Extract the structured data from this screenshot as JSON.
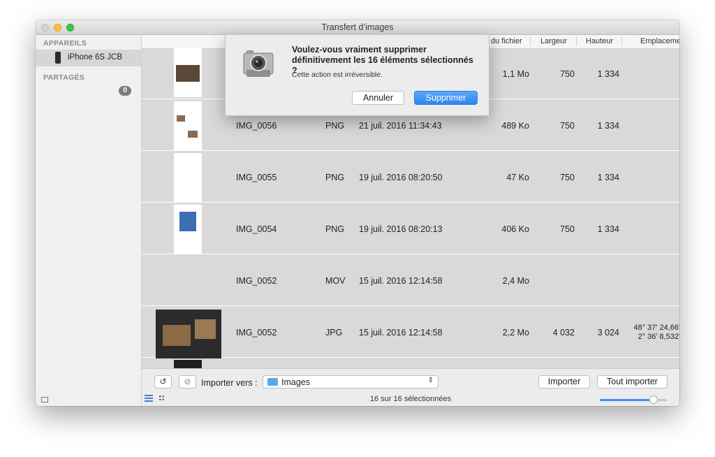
{
  "window": {
    "title": "Transfert d’images"
  },
  "sidebar": {
    "devices_header": "APPAREILS",
    "device_name": "iPhone 6S JCB",
    "shared_header": "PARTAGÉS",
    "shared_count": "0"
  },
  "columns": {
    "size": "du fichier",
    "width": "Largeur",
    "height": "Hauteur",
    "location": "Emplacement"
  },
  "rows": [
    {
      "name": "",
      "type": "",
      "date": "",
      "size": "1,1 Mo",
      "width": "750",
      "height": "1 334",
      "loc1": "",
      "loc2": ""
    },
    {
      "name": "IMG_0056",
      "type": "PNG",
      "date": "21 juil. 2016 11:34:43",
      "size": "489 Ko",
      "width": "750",
      "height": "1 334",
      "loc1": "",
      "loc2": ""
    },
    {
      "name": "IMG_0055",
      "type": "PNG",
      "date": "19 juil. 2016 08:20:50",
      "size": "47 Ko",
      "width": "750",
      "height": "1 334",
      "loc1": "",
      "loc2": ""
    },
    {
      "name": "IMG_0054",
      "type": "PNG",
      "date": "19 juil. 2016 08:20:13",
      "size": "406 Ko",
      "width": "750",
      "height": "1 334",
      "loc1": "",
      "loc2": ""
    },
    {
      "name": "IMG_0052",
      "type": "MOV",
      "date": "15 juil. 2016 12:14:58",
      "size": "2,4 Mo",
      "width": "",
      "height": "",
      "loc1": "",
      "loc2": ""
    },
    {
      "name": "IMG_0052",
      "type": "JPG",
      "date": "15 juil. 2016 12:14:58",
      "size": "2,2 Mo",
      "width": "4 032",
      "height": "3 024",
      "loc1": "48° 37' 24,66\"",
      "loc2": "2° 36' 8,532\""
    }
  ],
  "footer": {
    "import_to_label": "Importer vers :",
    "destination": "Images",
    "import_button": "Importer",
    "import_all_button": "Tout importer",
    "status": "16 sur 16 sélectionnées",
    "zoom_level": 0.8
  },
  "dialog": {
    "title": "Voulez-vous vraiment supprimer définitivement les 16 éléments sélectionnés ?",
    "message": "Cette action est irréversible.",
    "cancel": "Annuler",
    "confirm": "Supprimer"
  },
  "icons": [
    "phone-icon",
    "rotate-icon",
    "delete-icon",
    "folder-icon",
    "chevron-updown-icon",
    "list-view-icon",
    "grid-view-icon",
    "image-capture-app-icon"
  ],
  "colors": {
    "accent": "#2f86f0",
    "row_bg": "#d9d9d9"
  }
}
